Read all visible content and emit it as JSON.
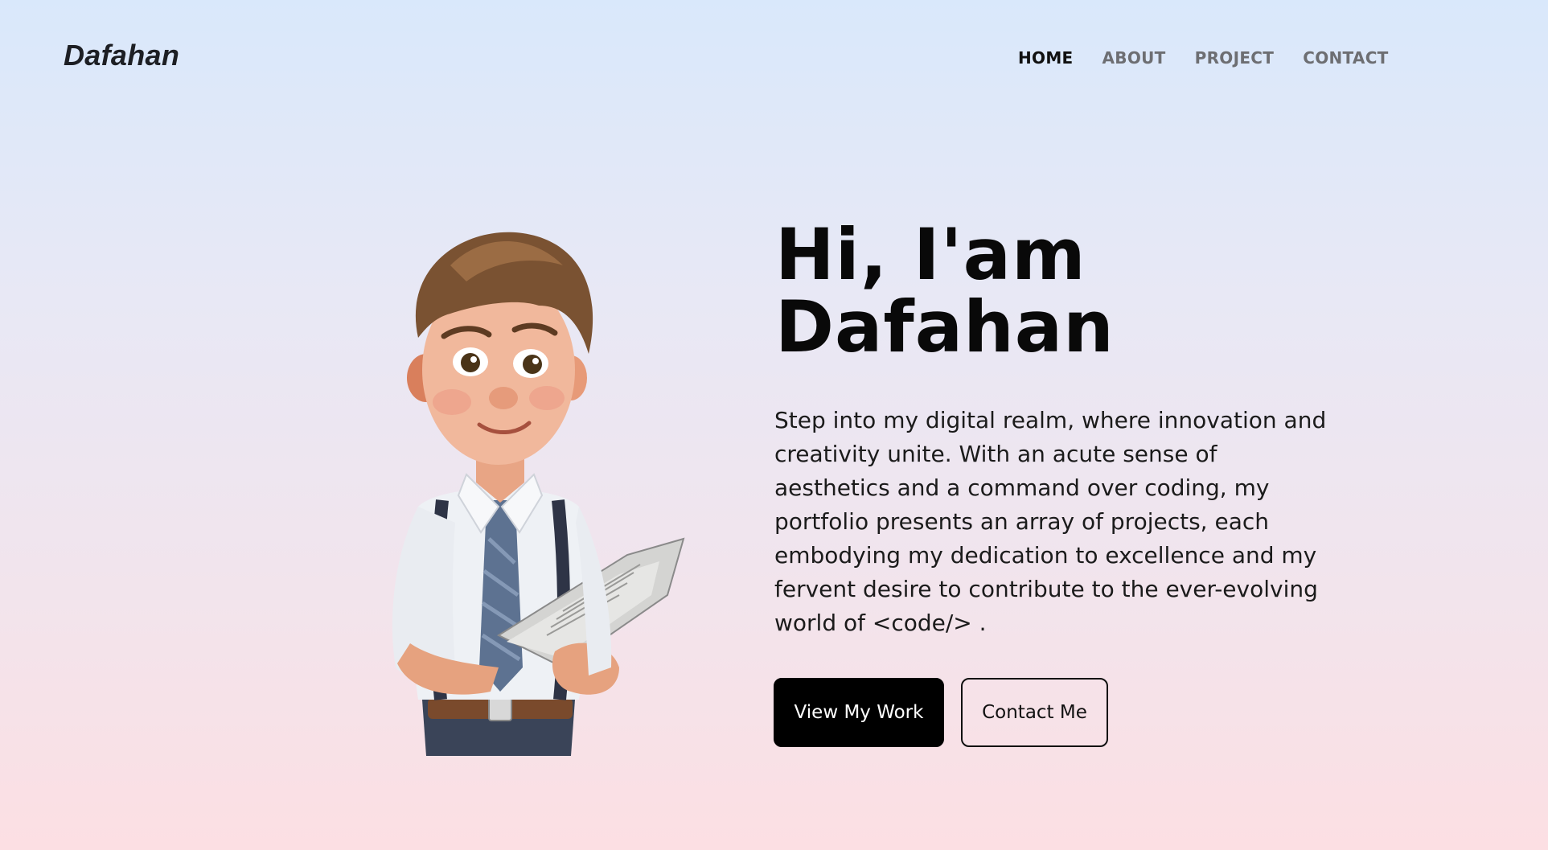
{
  "header": {
    "logo": "Dafahan",
    "nav": [
      {
        "label": "HOME",
        "active": true
      },
      {
        "label": "ABOUT",
        "active": false
      },
      {
        "label": "PROJECT",
        "active": false
      },
      {
        "label": "CONTACT",
        "active": false
      }
    ]
  },
  "hero": {
    "title_line1": "Hi, I'am",
    "title_line2": "Dafahan",
    "description": "Step into my digital realm, where innovation and creativity unite. With an acute sense of aesthetics and a command over coding, my portfolio presents an array of projects, each embodying my dedication to excellence and my fervent desire to contribute to the ever-evolving world of <code/> .",
    "primary_button": "View My Work",
    "secondary_button": "Contact Me",
    "image_subject": "cartoon boy reading a newspaper"
  },
  "colors": {
    "background_top": "#d9e8fb",
    "background_bottom": "#fcdfe3",
    "text": "#0b0b0b",
    "nav_inactive": "#6d6e72",
    "primary_button_bg": "#000000",
    "primary_button_text": "#ffffff"
  }
}
